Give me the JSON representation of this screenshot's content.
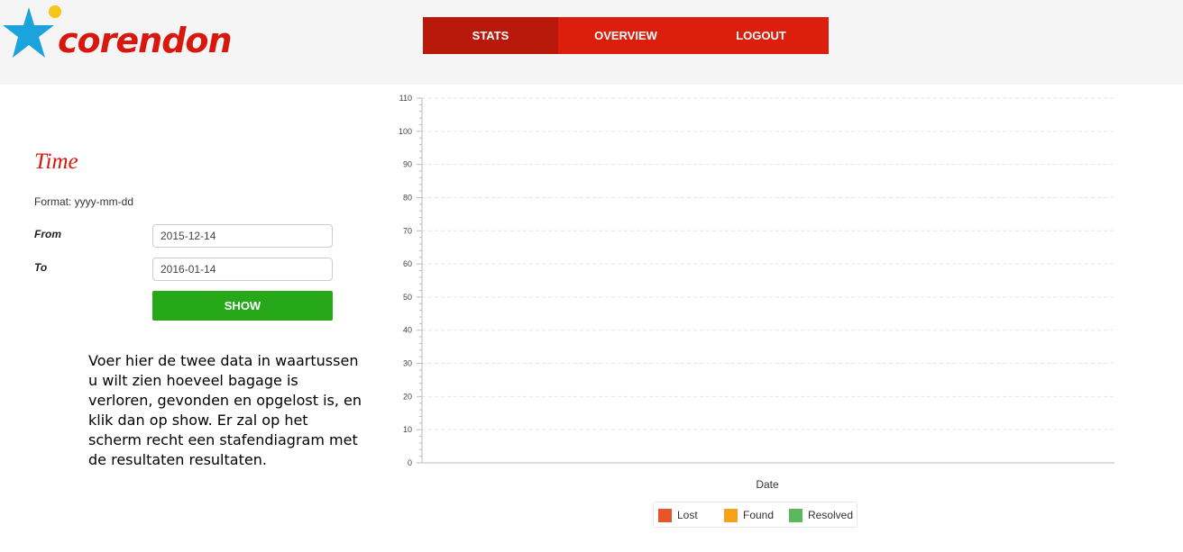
{
  "header": {
    "logo_text": "corendon",
    "nav": [
      {
        "label": "STATS"
      },
      {
        "label": "OVERVIEW"
      },
      {
        "label": "LOGOUT"
      }
    ]
  },
  "form": {
    "title": "Time",
    "format_hint": "Format: yyyy-mm-dd",
    "from_label": "From",
    "from_value": "2015-12-14",
    "to_label": "To",
    "to_value": "2016-01-14",
    "show_label": "SHOW",
    "help_text": "Voer hier de twee data in waartussen u wilt zien hoeveel bagage is verloren, gevonden en opgelost is, en klik dan op show. Er zal op het scherm recht een stafendiagram met de resultaten resultaten."
  },
  "colors": {
    "brand_red": "#dc1e0c",
    "nav_active": "#b9190a",
    "show_green": "#27a818",
    "lost": "#e8542a",
    "found": "#f5a21a",
    "resolved": "#5cb85c"
  },
  "chart_data": {
    "type": "bar",
    "categories": [],
    "series": [
      {
        "name": "Lost",
        "values": []
      },
      {
        "name": "Found",
        "values": []
      },
      {
        "name": "Resolved",
        "values": []
      }
    ],
    "xlabel": "Date",
    "ylabel": "",
    "ylim": [
      0,
      110
    ],
    "yticks": [
      "0",
      "10",
      "20",
      "30",
      "40",
      "50",
      "60",
      "70",
      "80",
      "90",
      "100",
      "110"
    ],
    "grid": true,
    "legend": "bottom"
  }
}
